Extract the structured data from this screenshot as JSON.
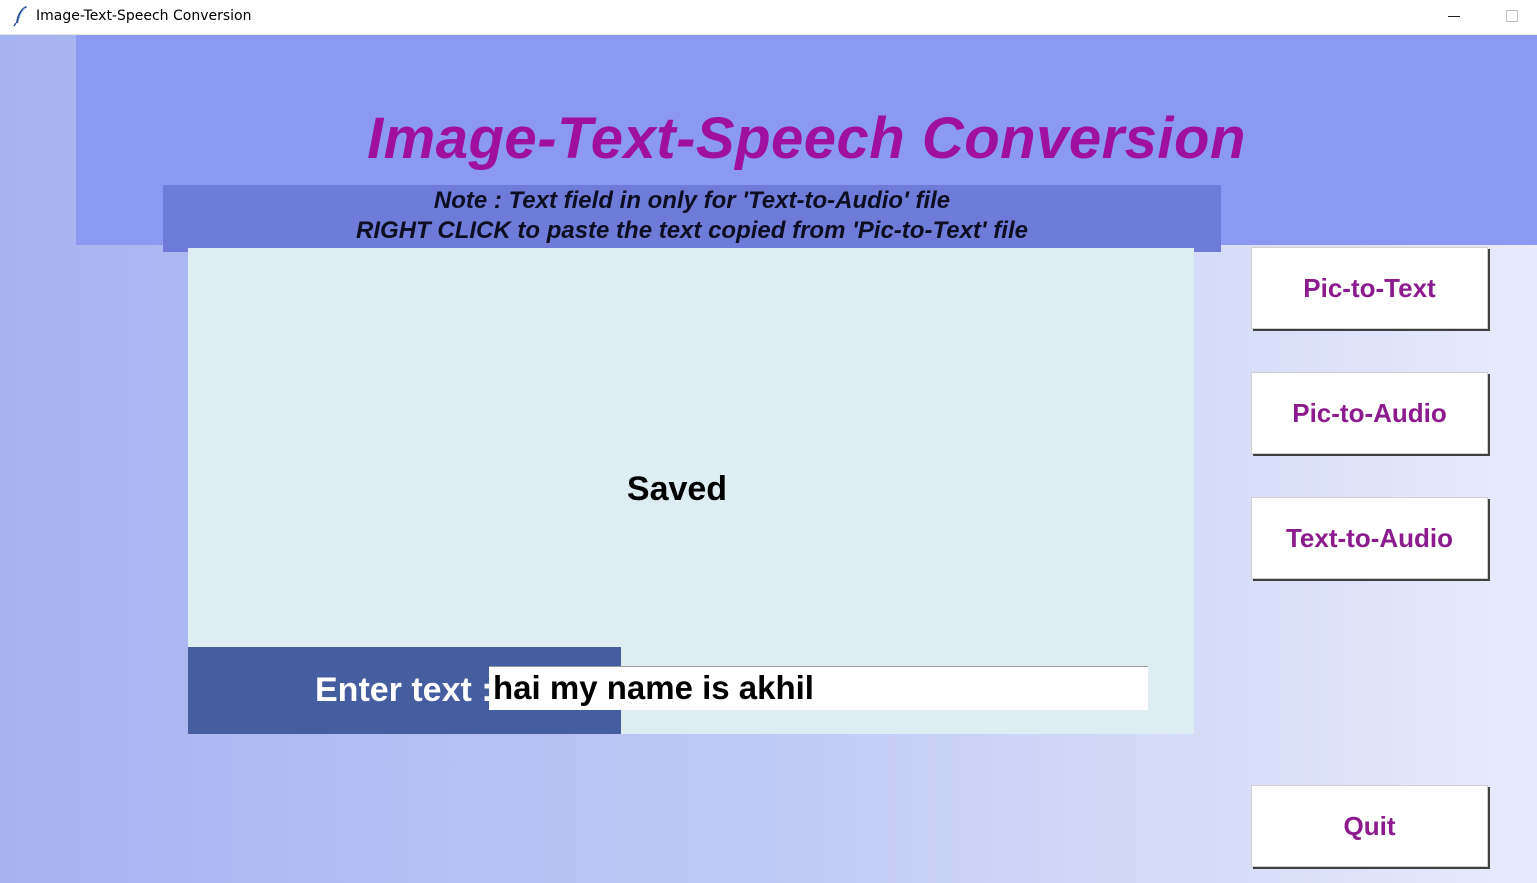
{
  "window": {
    "title": "Image-Text-Speech Conversion",
    "icon": "feather-icon"
  },
  "header": {
    "title": "Image-Text-Speech Conversion",
    "note_line1": "Note : Text field in only for 'Text-to-Audio' file",
    "note_line2": "RIGHT CLICK to paste the text copied from 'Pic-to-Text' file"
  },
  "main": {
    "status": "Saved",
    "enter_label": "Enter text :",
    "input_value": "hai my name is akhil"
  },
  "buttons": {
    "pic_to_text": "Pic-to-Text",
    "pic_to_audio": "Pic-to-Audio",
    "text_to_audio": "Text-to-Audio",
    "quit": "Quit"
  },
  "colors": {
    "title": "#9f0fa0",
    "header_band": "#8c99f2",
    "note_band": "#6e7bd8",
    "panel": "#ddedf1",
    "enter_band": "#455e9f",
    "button_text": "#8c1c8e"
  }
}
